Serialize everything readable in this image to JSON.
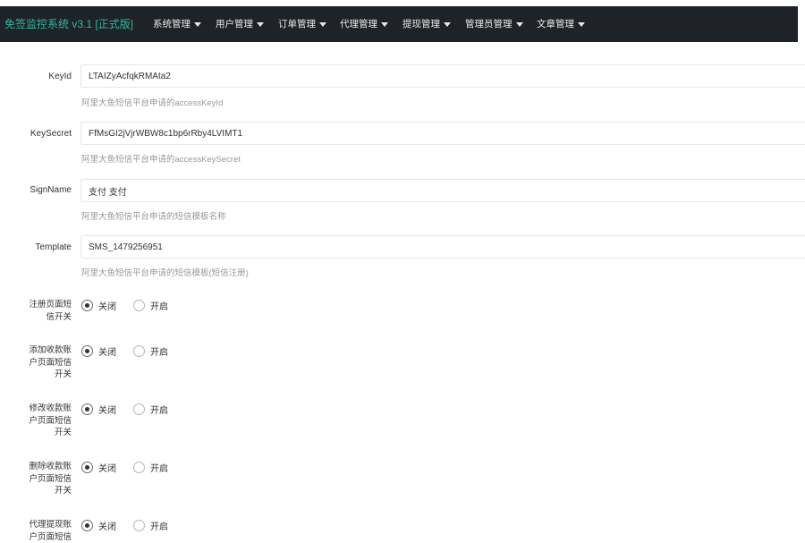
{
  "header": {
    "brand": "免签监控系统 v3.1 [正式版]",
    "menu": [
      {
        "label": "系统管理"
      },
      {
        "label": "用户管理"
      },
      {
        "label": "订单管理"
      },
      {
        "label": "代理管理"
      },
      {
        "label": "提现管理"
      },
      {
        "label": "管理员管理"
      },
      {
        "label": "文章管理"
      }
    ]
  },
  "form": {
    "keyid": {
      "label": "KeyId",
      "value": "LTAIZyAcfqkRMAta2",
      "help": "阿里大鱼短信平台申请的accessKeyId"
    },
    "keysecret": {
      "label": "KeySecret",
      "value": "FfMsGI2jVjrWBW8c1bp6rRby4LVIMT1",
      "help": "阿里大鱼短信平台申请的accessKeySecret"
    },
    "signname": {
      "label": "SignName",
      "value": "支付 支付",
      "help": "阿里大鱼短信平台申请的短信模板名称"
    },
    "template": {
      "label": "Template",
      "value": "SMS_1479256951",
      "help": "阿里大鱼短信平台申请的短信模板(短信注册)"
    },
    "switches": [
      {
        "label": "注册页面短信开关",
        "off": "关闭",
        "on": "开启",
        "selected": "off"
      },
      {
        "label": "添加收款账户页面短信开关",
        "off": "关闭",
        "on": "开启",
        "selected": "off"
      },
      {
        "label": "修改收款账户页面短信开关",
        "off": "关闭",
        "on": "开启",
        "selected": "off"
      },
      {
        "label": "删除收款账户页面短信开关",
        "off": "关闭",
        "on": "开启",
        "selected": "off"
      },
      {
        "label": "代理提现账户页面短信",
        "off": "关闭",
        "on": "开启",
        "selected": "off"
      }
    ]
  }
}
